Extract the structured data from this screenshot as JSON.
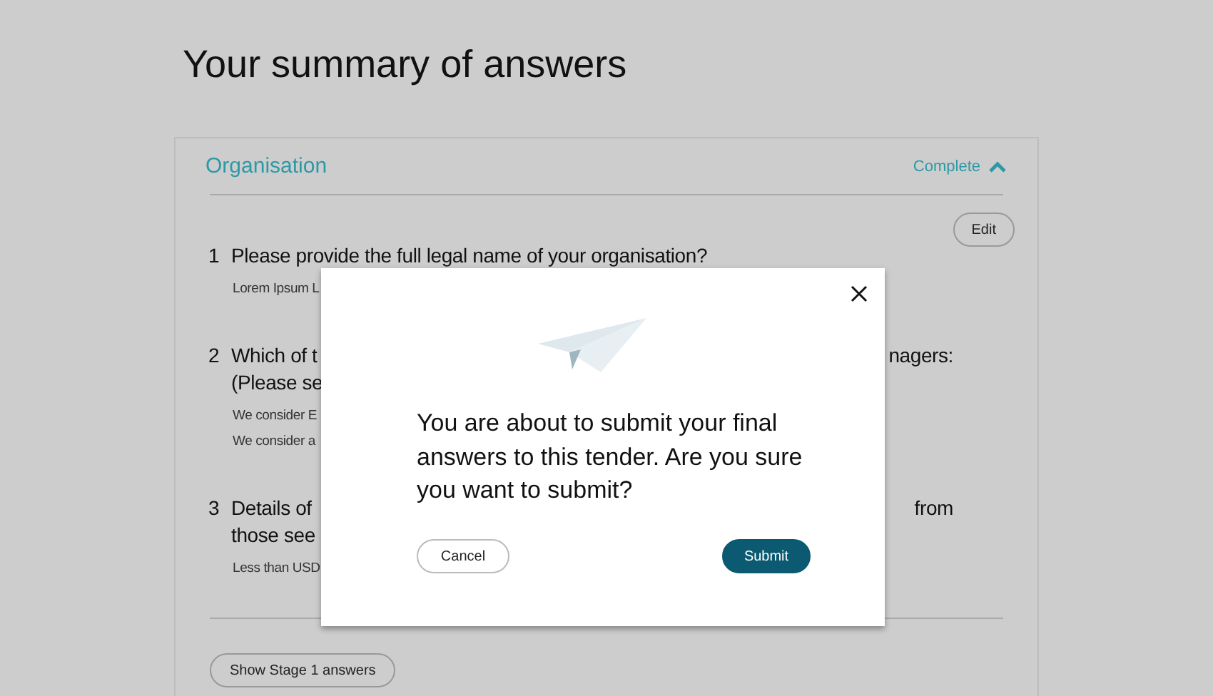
{
  "page": {
    "title": "Your summary of answers"
  },
  "section": {
    "title": "Organisation",
    "status": "Complete",
    "expanded": true,
    "edit_button": "Edit",
    "questions": [
      {
        "number": "1",
        "lines": [
          [
            "Please provide the full legal name of your organisation?"
          ]
        ],
        "answers": [
          "Lorem Ipsum L"
        ]
      },
      {
        "number": "2",
        "lines": [
          [
            "Which of t",
            "nagers:"
          ],
          [
            "(Please se"
          ]
        ],
        "answers": [
          "We consider E",
          "We consider a"
        ]
      },
      {
        "number": "3",
        "lines": [
          [
            "Details of",
            "from"
          ],
          [
            "those see"
          ]
        ],
        "answers": [
          "Less than USD"
        ]
      }
    ],
    "footer_button": "Show Stage 1 answers"
  },
  "dialog": {
    "message": "You are about to submit your final answers to this tender. Are you sure you want to submit?",
    "buttons": [
      {
        "label": "Cancel",
        "kind": "secondary"
      },
      {
        "label": "Submit",
        "kind": "primary"
      }
    ]
  }
}
